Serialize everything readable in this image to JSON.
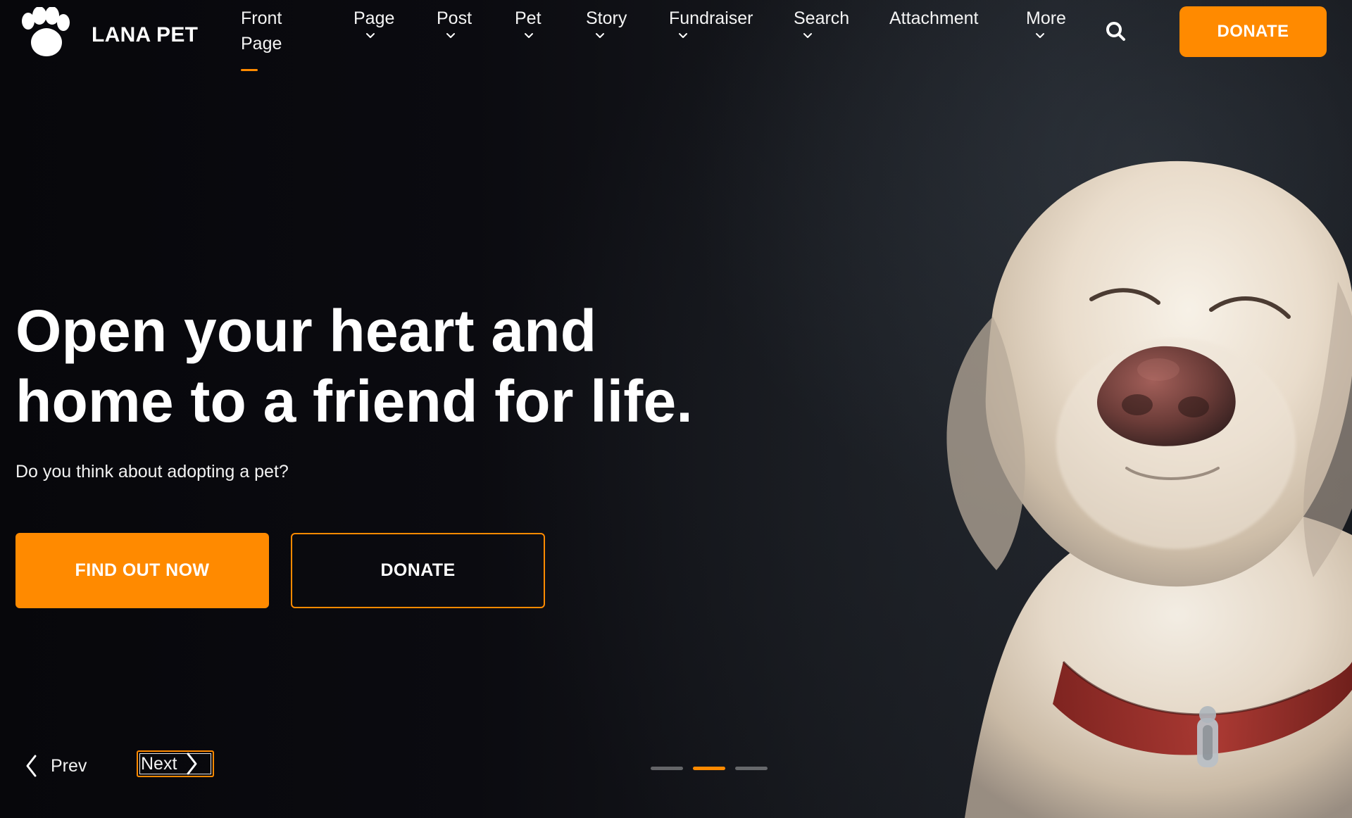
{
  "brand": {
    "name": "LANA PET",
    "logo_icon": "paw-icon"
  },
  "nav": {
    "items": [
      {
        "label": "Front\nPage",
        "has_dropdown": false,
        "active": true
      },
      {
        "label": "Page",
        "has_dropdown": true,
        "active": false
      },
      {
        "label": "Post",
        "has_dropdown": true,
        "active": false
      },
      {
        "label": "Pet",
        "has_dropdown": true,
        "active": false
      },
      {
        "label": "Story",
        "has_dropdown": true,
        "active": false
      },
      {
        "label": "Fundraiser",
        "has_dropdown": true,
        "active": false
      },
      {
        "label": "Search",
        "has_dropdown": true,
        "active": false
      },
      {
        "label": "Attachment",
        "has_dropdown": false,
        "active": false
      },
      {
        "label": "More",
        "has_dropdown": true,
        "active": false
      }
    ],
    "search_icon": "search-icon",
    "donate_label": "DONATE"
  },
  "hero": {
    "headline_line1": "Open your heart and",
    "headline_line2": "home to a friend for life.",
    "subtext": "Do you think about adopting a pet?",
    "primary_cta": "FIND OUT NOW",
    "secondary_cta": "DONATE"
  },
  "slider": {
    "prev_label": "Prev",
    "next_label": "Next",
    "dots_total": 3,
    "active_index": 1
  },
  "colors": {
    "accent": "#ff8a00",
    "background": "#0b0b0f",
    "text": "#ffffff"
  }
}
